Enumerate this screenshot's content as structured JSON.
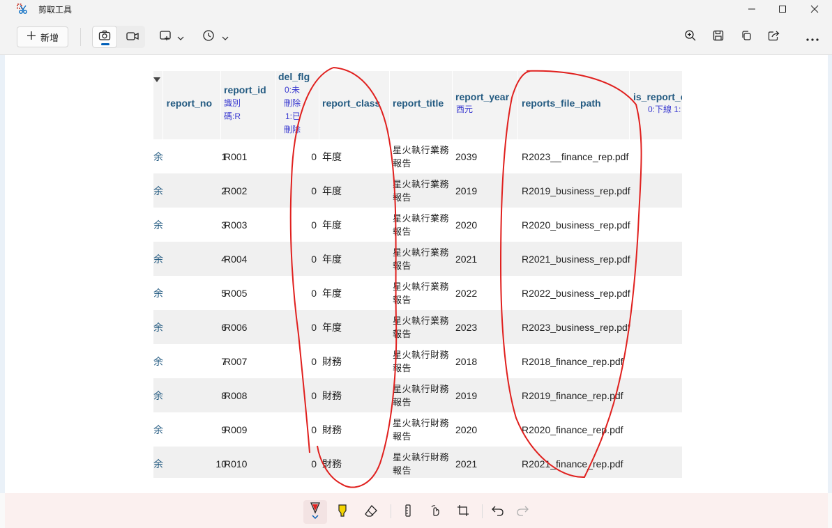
{
  "window": {
    "title": "剪取工具",
    "controls": [
      "minimize",
      "maximize",
      "close"
    ]
  },
  "toolbar": {
    "new_label": "新增",
    "new_icon": "plus-icon",
    "modes": [
      "camera-icon",
      "video-icon"
    ],
    "active_mode": "camera-icon",
    "shape_icon": "rectangle-snip-icon",
    "timer_icon": "clock-icon",
    "right_icons": [
      "zoom-in-icon",
      "save-icon",
      "copy-icon",
      "share-icon",
      "more-icon"
    ]
  },
  "table": {
    "columns": [
      {
        "name": "report_no",
        "sub": []
      },
      {
        "name": "report_id",
        "sub": [
          "識別",
          "碼:R"
        ]
      },
      {
        "name": "del_flg",
        "sub": [
          "0:未",
          "刪除",
          "1:已",
          "刪除"
        ]
      },
      {
        "name": "report_class",
        "sub": []
      },
      {
        "name": "report_title",
        "sub": []
      },
      {
        "name": "report_year",
        "sub": [
          "西元"
        ]
      },
      {
        "name": "reports_file_path",
        "sub": []
      },
      {
        "name": "is_report_c",
        "sub": [
          "0:下線 1:"
        ]
      }
    ],
    "delete_fragment": "余",
    "rows": [
      {
        "no": "1",
        "id": "R001",
        "del": "0",
        "cls": "年度",
        "title": [
          "星火執行業務",
          "報告"
        ],
        "year": "2039",
        "path": "R2023__finance_rep.pdf"
      },
      {
        "no": "2",
        "id": "R002",
        "del": "0",
        "cls": "年度",
        "title": [
          "星火執行業務",
          "報告"
        ],
        "year": "2019",
        "path": "R2019_business_rep.pdf"
      },
      {
        "no": "3",
        "id": "R003",
        "del": "0",
        "cls": "年度",
        "title": [
          "星火執行業務",
          "報告"
        ],
        "year": "2020",
        "path": "R2020_business_rep.pdf"
      },
      {
        "no": "4",
        "id": "R004",
        "del": "0",
        "cls": "年度",
        "title": [
          "星火執行業務",
          "報告"
        ],
        "year": "2021",
        "path": "R2021_business_rep.pdf"
      },
      {
        "no": "5",
        "id": "R005",
        "del": "0",
        "cls": "年度",
        "title": [
          "星火執行業務",
          "報告"
        ],
        "year": "2022",
        "path": "R2022_business_rep.pdf"
      },
      {
        "no": "6",
        "id": "R006",
        "del": "0",
        "cls": "年度",
        "title": [
          "星火執行業務",
          "報告"
        ],
        "year": "2023",
        "path": "R2023_business_rep.pdf"
      },
      {
        "no": "7",
        "id": "R007",
        "del": "0",
        "cls": "財務",
        "title": [
          "星火執行財務",
          "報告"
        ],
        "year": "2018",
        "path": "R2018_finance_rep.pdf"
      },
      {
        "no": "8",
        "id": "R008",
        "del": "0",
        "cls": "財務",
        "title": [
          "星火執行財務",
          "報告"
        ],
        "year": "2019",
        "path": "R2019_finance_rep.pdf"
      },
      {
        "no": "9",
        "id": "R009",
        "del": "0",
        "cls": "財務",
        "title": [
          "星火執行財務",
          "報告"
        ],
        "year": "2020",
        "path": "R2020_finance_rep.pdf"
      },
      {
        "no": "10",
        "id": "R010",
        "del": "0",
        "cls": "財務",
        "title": [
          "星火執行財務",
          "報告"
        ],
        "year": "2021",
        "path": "R2021_finance_rep.pdf"
      }
    ]
  },
  "bottom_tools": [
    "ballpoint-pen-icon",
    "highlighter-icon",
    "eraser-icon",
    "ruler-icon",
    "touch-writing-icon",
    "crop-icon",
    "undo-icon",
    "redo-icon"
  ],
  "active_tool": "ballpoint-pen-icon",
  "colors": {
    "pen": "#e0201e",
    "highlighter": "#f5d400",
    "accent": "#005fb8",
    "link": "#235a81"
  }
}
